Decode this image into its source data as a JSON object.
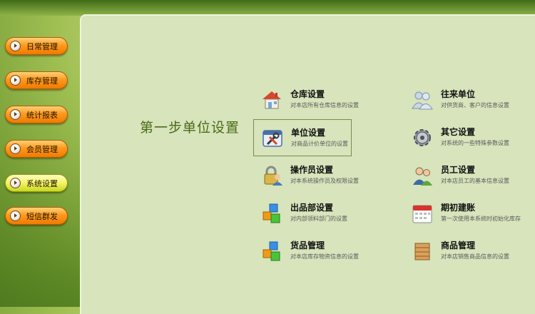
{
  "nav": {
    "items": [
      {
        "label": "日常管理"
      },
      {
        "label": "库存管理"
      },
      {
        "label": "统计报表"
      },
      {
        "label": "会员管理"
      },
      {
        "label": "系统设置"
      },
      {
        "label": "短信群发"
      }
    ],
    "active": "系统设置"
  },
  "main": {
    "step_title": "第一步单位设置",
    "left_items": [
      {
        "title": "仓库设置",
        "desc": "对本店所有仓库信息的设置",
        "icon": "house-icon"
      },
      {
        "title": "单位设置",
        "desc": "对商品计价单位的设置",
        "icon": "tools-icon"
      },
      {
        "title": "操作员设置",
        "desc": "对本系统操作员及权限设置",
        "icon": "lock-user-icon"
      },
      {
        "title": "出品部设置",
        "desc": "对内部领料部门的设置",
        "icon": "cubes-icon"
      },
      {
        "title": "货品管理",
        "desc": "对本店库存物资信息的设置",
        "icon": "cubes-icon"
      }
    ],
    "right_items": [
      {
        "title": "往来单位",
        "desc": "对供货商、客户的信息设置",
        "icon": "people-icon"
      },
      {
        "title": "其它设置",
        "desc": "对系统的一些特殊参数设置",
        "icon": "gear-icon"
      },
      {
        "title": "员工设置",
        "desc": "对本店员工的基本信息设置",
        "icon": "staff-icon"
      },
      {
        "title": "期初建账",
        "desc": "第一次使用本系统时初始化库存",
        "icon": "calendar-icon"
      },
      {
        "title": "商品管理",
        "desc": "对本店销售商品信息的设置",
        "icon": "box-icon"
      }
    ],
    "selected": "单位设置"
  }
}
